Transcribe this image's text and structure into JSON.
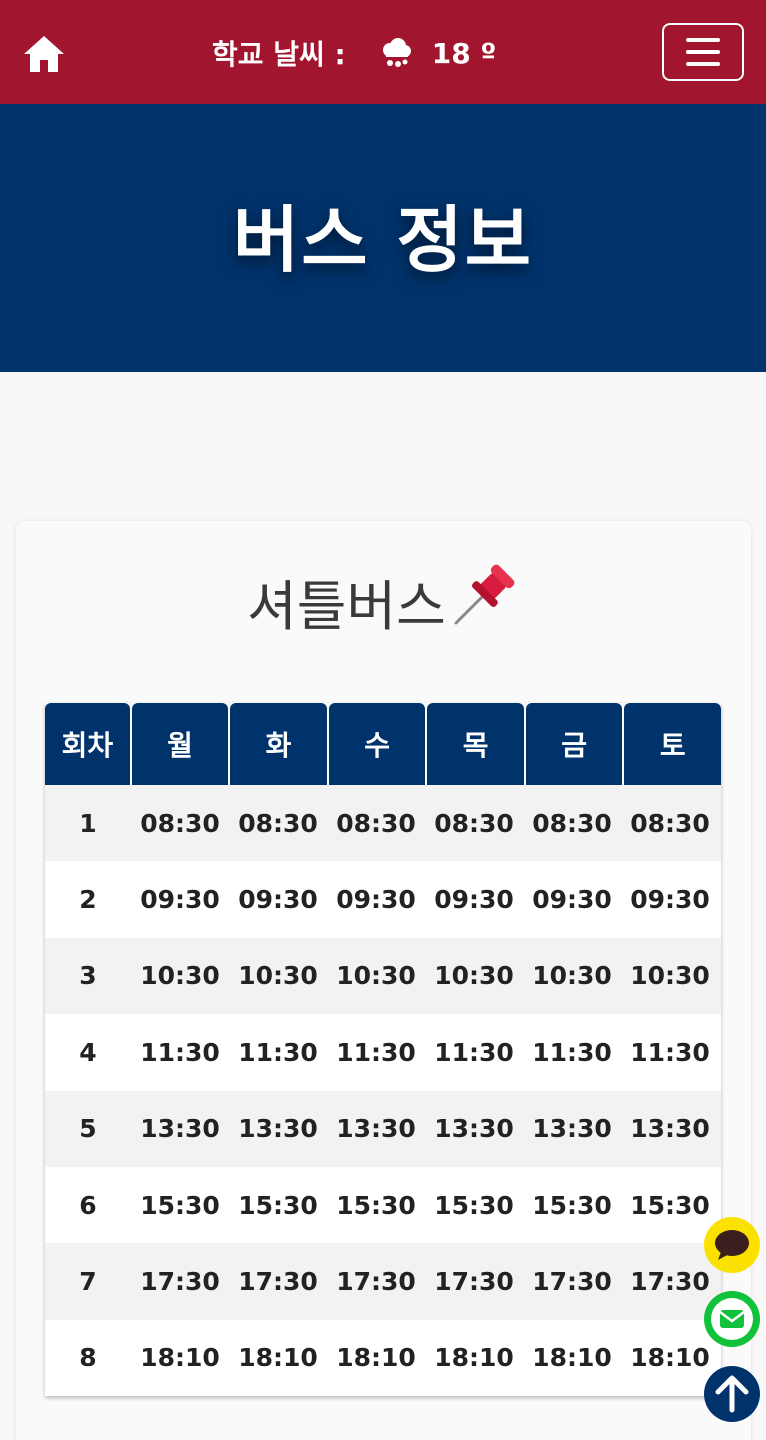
{
  "header": {
    "weather_label": "학교 날씨 :",
    "weather_icon": "cloud-rain-icon",
    "temperature": "18 º",
    "home_icon": "home-icon",
    "menu_icon": "hamburger-menu-icon"
  },
  "hero": {
    "title": "버스 정보"
  },
  "card": {
    "title": "셔틀버스",
    "title_emoji": "📌"
  },
  "table": {
    "headers": [
      "회차",
      "월",
      "화",
      "수",
      "목",
      "금",
      "토"
    ],
    "rows": [
      [
        "1",
        "08:30",
        "08:30",
        "08:30",
        "08:30",
        "08:30",
        "08:30"
      ],
      [
        "2",
        "09:30",
        "09:30",
        "09:30",
        "09:30",
        "09:30",
        "09:30"
      ],
      [
        "3",
        "10:30",
        "10:30",
        "10:30",
        "10:30",
        "10:30",
        "10:30"
      ],
      [
        "4",
        "11:30",
        "11:30",
        "11:30",
        "11:30",
        "11:30",
        "11:30"
      ],
      [
        "5",
        "13:30",
        "13:30",
        "13:30",
        "13:30",
        "13:30",
        "13:30"
      ],
      [
        "6",
        "15:30",
        "15:30",
        "15:30",
        "15:30",
        "15:30",
        "15:30"
      ],
      [
        "7",
        "17:30",
        "17:30",
        "17:30",
        "17:30",
        "17:30",
        "17:30"
      ],
      [
        "8",
        "18:10",
        "18:10",
        "18:10",
        "18:10",
        "18:10",
        "18:10"
      ]
    ]
  },
  "floating_buttons": {
    "chat_icon": "chat-bubble-icon",
    "mail_icon": "envelope-icon",
    "top_icon": "arrow-up-icon"
  },
  "colors": {
    "header_bg": "#a1152e",
    "hero_bg": "#00326b",
    "table_header_bg": "#00326b",
    "chat_bg": "#fae100",
    "mail_bg": "#10c23a",
    "top_bg": "#00326b"
  }
}
